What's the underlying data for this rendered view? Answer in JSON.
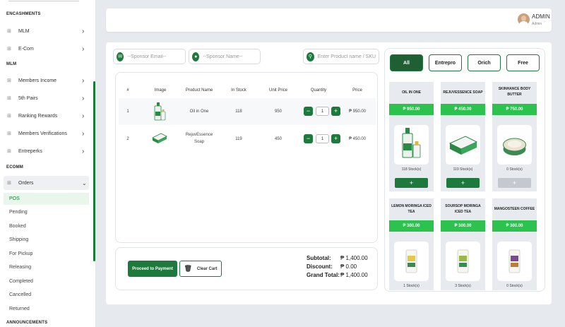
{
  "sidebar": {
    "sections": [
      "ENCASHMENTS",
      "MLM",
      "ECOMM",
      "ANNOUNCEMENTS"
    ],
    "items": [
      {
        "label": "MLM"
      },
      {
        "label": "E-Com"
      },
      {
        "label": "Members Income"
      },
      {
        "label": "5th Pairs"
      },
      {
        "label": "Ranking Rewards"
      },
      {
        "label": "Members Verifications"
      },
      {
        "label": "Entreperks"
      }
    ],
    "orders": {
      "label": "Orders",
      "sub": [
        "POS",
        "Pending",
        "Booked",
        "Shipping",
        "For Pickup",
        "Releasing",
        "Completed",
        "Cancelled",
        "Returned"
      ]
    }
  },
  "header": {
    "user_name": "ADMIN",
    "user_role": "Admin"
  },
  "search": {
    "sponsor_email_placeholder": "--Sponsor Email--",
    "sponsor_name_placeholder": "--Sponsor Name--",
    "product_placeholder": "Enter Product name / SKU"
  },
  "cart": {
    "columns": [
      "#",
      "Image",
      "Product Name",
      "In Stock",
      "Unit Price",
      "Quantity",
      "Price"
    ],
    "rows": [
      {
        "num": "1",
        "name": "Oil in One",
        "name2": "",
        "stock": "118",
        "unit_price": "950",
        "qty": "1",
        "price": "₱ 950.00"
      },
      {
        "num": "2",
        "name": "RejuvEssence",
        "name2": "Soap",
        "stock": "119",
        "unit_price": "450",
        "qty": "1",
        "price": "₱ 450.00"
      }
    ]
  },
  "footer": {
    "pay_label": "Proceed to Payment",
    "clear_label": "Clear Cart",
    "subtotal_label": "Subtotal:",
    "subtotal": "₱ 1,400.00",
    "discount_label": "Discount:",
    "discount": "₱ 0.00",
    "grand_label": "Grand Total:",
    "grand": "₱ 1,400.00"
  },
  "filters": [
    "All",
    "Entrepro",
    "Orich",
    "Free"
  ],
  "products": [
    {
      "name": "OIL IN ONE",
      "name2": "",
      "price": "₱ 950.00",
      "stock": "118 Stock(s)",
      "add": "+"
    },
    {
      "name": "REJUVESSENCE SOAP",
      "name2": "",
      "price": "₱ 450.00",
      "stock": "119 Stock(s)",
      "add": "+"
    },
    {
      "name": "SKINHANCE BODY",
      "name2": "BUTTER",
      "price": "₱ 750.00",
      "stock": "0 Stock(s)",
      "add": "+"
    },
    {
      "name": "LEMON MORINGA ICED",
      "name2": "TEA",
      "price": "₱ 300.00",
      "stock": "1 Stock(s)"
    },
    {
      "name": "SOURSOP MORINGA",
      "name2": "ICED TEA",
      "price": "₱ 300.00",
      "stock": "3 Stock(s)"
    },
    {
      "name": "MANGOSTEEN COFFEE",
      "name2": "",
      "price": "₱ 300.00",
      "stock": "0 Stock(s)"
    }
  ],
  "colors": {
    "brand_green": "#1e7a3c",
    "price_green": "#2bc24d",
    "active_filter": "#1e5f33"
  }
}
